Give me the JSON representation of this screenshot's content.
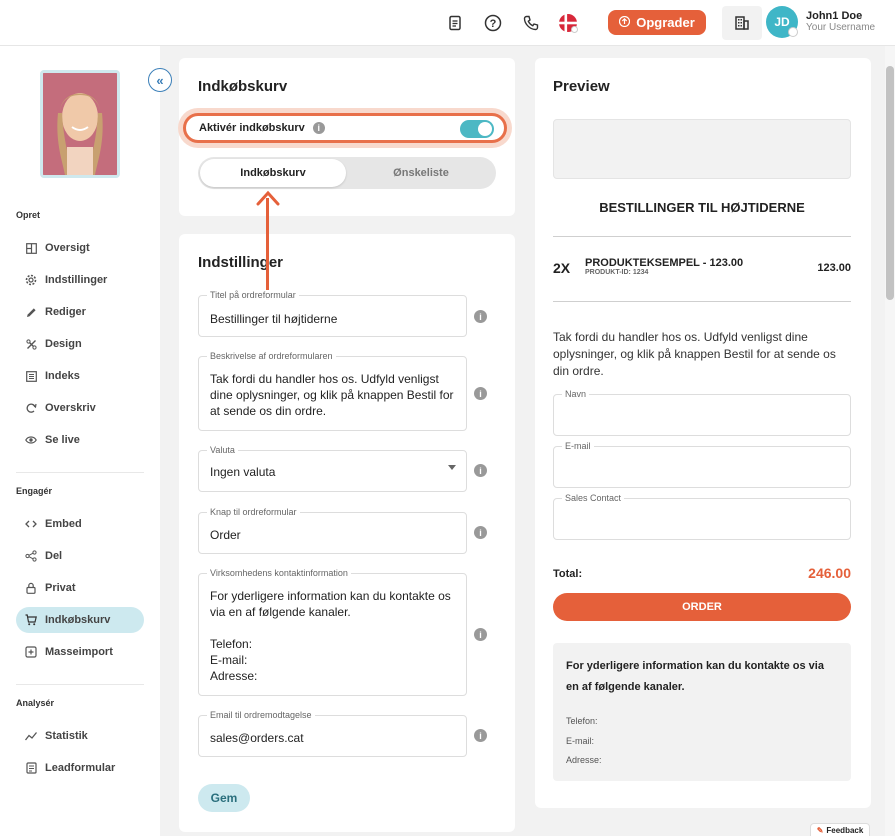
{
  "topbar": {
    "upgrade_label": "Opgrader",
    "user_initials": "JD",
    "user_name": "John1 Doe",
    "user_sub": "Your Username"
  },
  "sidebar": {
    "sections": {
      "opret": "Opret",
      "engager": "Engagér",
      "analyser": "Analysér"
    },
    "items": [
      {
        "label": "Oversigt",
        "icon": "overview-icon"
      },
      {
        "label": "Indstillinger",
        "icon": "settings-icon"
      },
      {
        "label": "Rediger",
        "icon": "edit-icon"
      },
      {
        "label": "Design",
        "icon": "design-icon"
      },
      {
        "label": "Indeks",
        "icon": "index-icon"
      },
      {
        "label": "Overskriv",
        "icon": "overwrite-icon"
      },
      {
        "label": "Se live",
        "icon": "eye-icon"
      },
      {
        "label": "Embed",
        "icon": "embed-icon"
      },
      {
        "label": "Del",
        "icon": "share-icon"
      },
      {
        "label": "Privat",
        "icon": "lock-icon"
      },
      {
        "label": "Indkøbskurv",
        "icon": "cart-icon",
        "active": true
      },
      {
        "label": "Masseimport",
        "icon": "import-icon"
      },
      {
        "label": "Statistik",
        "icon": "stats-icon"
      },
      {
        "label": "Leadformular",
        "icon": "form-icon"
      }
    ]
  },
  "cart_card": {
    "title": "Indkøbskurv",
    "toggle_label": "Aktivér indkøbskurv",
    "toggle_on": true,
    "tab_cart": "Indkøbskurv",
    "tab_wishlist": "Ønskeliste"
  },
  "settings": {
    "title": "Indstillinger",
    "fields": [
      {
        "label": "Titel på ordreformular",
        "value": "Bestillinger til højtiderne"
      },
      {
        "label": "Beskrivelse af ordreformularen",
        "value": "Tak fordi du handler hos os. Udfyld venligst dine oplysninger, og klik på knappen Bestil for at sende os din ordre."
      },
      {
        "label": "Valuta",
        "value": "Ingen valuta"
      },
      {
        "label": "Knap til ordreformular",
        "value": "Order"
      },
      {
        "label": "Virksomhedens kontaktinformation",
        "value": "For yderligere information kan du kontakte os via en af følgende kanaler.\n\nTelefon:\nE-mail:\nAdresse:"
      },
      {
        "label": "Email til ordremodtagelse",
        "value": "sales@orders.cat"
      }
    ],
    "save_label": "Gem"
  },
  "preview": {
    "title": "Preview",
    "heading": "BESTILLINGER TIL HØJTIDERNE",
    "qty": "2X",
    "product": "PRODUKTEKSEMPEL -  123.00",
    "product_id": "PRODUKT-ID: 1234",
    "price": "123.00",
    "text": "Tak fordi du handler hos os. Udfyld venligst dine oplysninger, og klik på knappen Bestil for at sende os din ordre.",
    "inputs": [
      "Navn",
      "E-mail",
      "Sales Contact"
    ],
    "total_label": "Total:",
    "total_value": "246.00",
    "order_label": "ORDER",
    "contact_title": "For yderligere information kan du kontakte os via en af følgende kanaler.",
    "contact_lines": [
      "Telefon:",
      "E-mail:",
      "Adresse:"
    ]
  },
  "feedback_label": "Feedback",
  "colors": {
    "accent": "#e5603a",
    "teal": "#4cb8c4",
    "active_bg": "#cde9ef"
  }
}
